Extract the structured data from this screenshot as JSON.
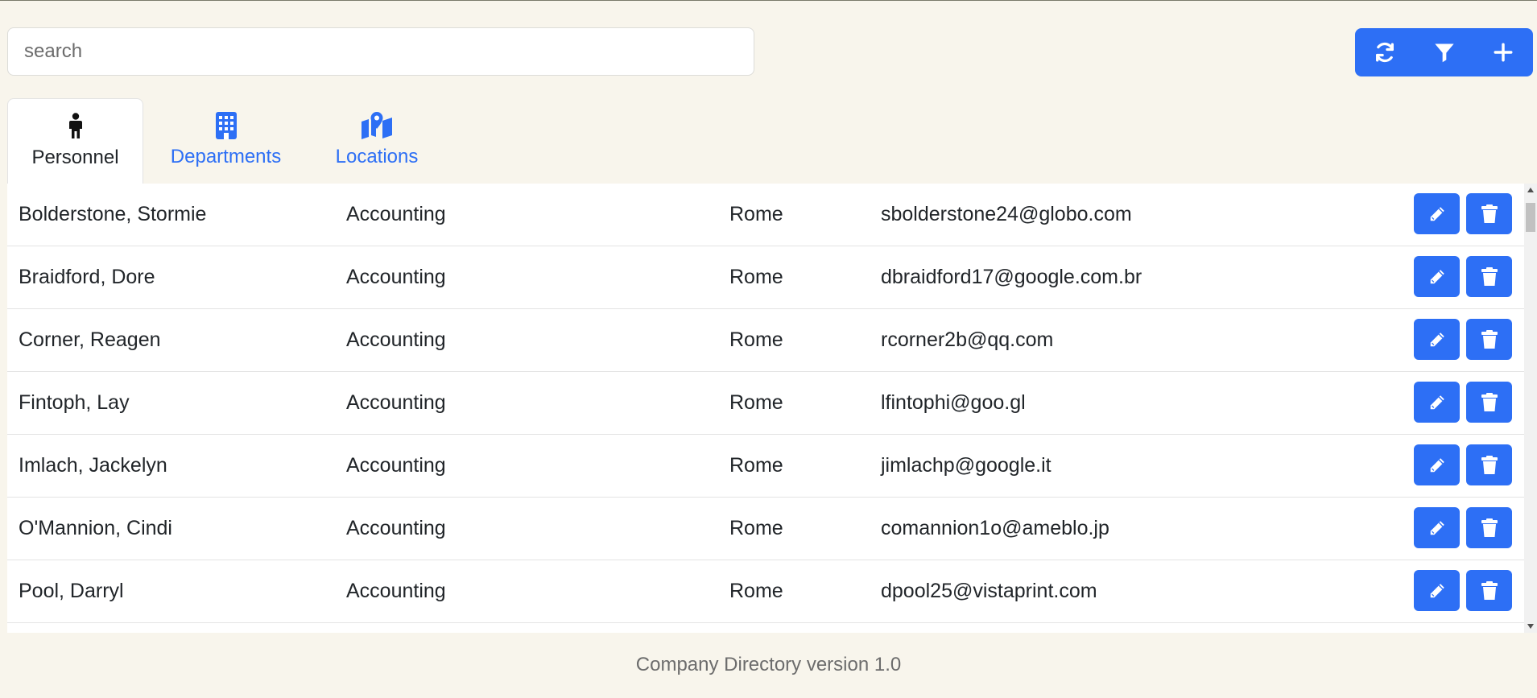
{
  "search": {
    "placeholder": "search",
    "value": ""
  },
  "toolbar": {
    "refresh_icon": "refresh-icon",
    "filter_icon": "filter-icon",
    "add_icon": "plus-icon"
  },
  "tabs": [
    {
      "label": "Personnel",
      "icon": "person-icon",
      "active": true
    },
    {
      "label": "Departments",
      "icon": "building-icon",
      "active": false
    },
    {
      "label": "Locations",
      "icon": "map-location-icon",
      "active": false
    }
  ],
  "rows": [
    {
      "name": "Bolderstone, Stormie",
      "department": "Accounting",
      "location": "Rome",
      "email": "sbolderstone24@globo.com"
    },
    {
      "name": "Braidford, Dore",
      "department": "Accounting",
      "location": "Rome",
      "email": "dbraidford17@google.com.br"
    },
    {
      "name": "Corner, Reagen",
      "department": "Accounting",
      "location": "Rome",
      "email": "rcorner2b@qq.com"
    },
    {
      "name": "Fintoph, Lay",
      "department": "Accounting",
      "location": "Rome",
      "email": "lfintophi@goo.gl"
    },
    {
      "name": "Imlach, Jackelyn",
      "department": "Accounting",
      "location": "Rome",
      "email": "jimlachp@google.it"
    },
    {
      "name": "O'Mannion, Cindi",
      "department": "Accounting",
      "location": "Rome",
      "email": "comannion1o@ameblo.jp"
    },
    {
      "name": "Pool, Darryl",
      "department": "Accounting",
      "location": "Rome",
      "email": "dpool25@vistaprint.com"
    },
    {
      "name": "",
      "department": "",
      "location": "",
      "email": ""
    }
  ],
  "row_actions": {
    "edit_icon": "pencil-icon",
    "delete_icon": "trash-icon"
  },
  "footer": {
    "text": "Company Directory version 1.0"
  },
  "colors": {
    "accent": "#2d6ff5",
    "background": "#f8f5ec"
  }
}
